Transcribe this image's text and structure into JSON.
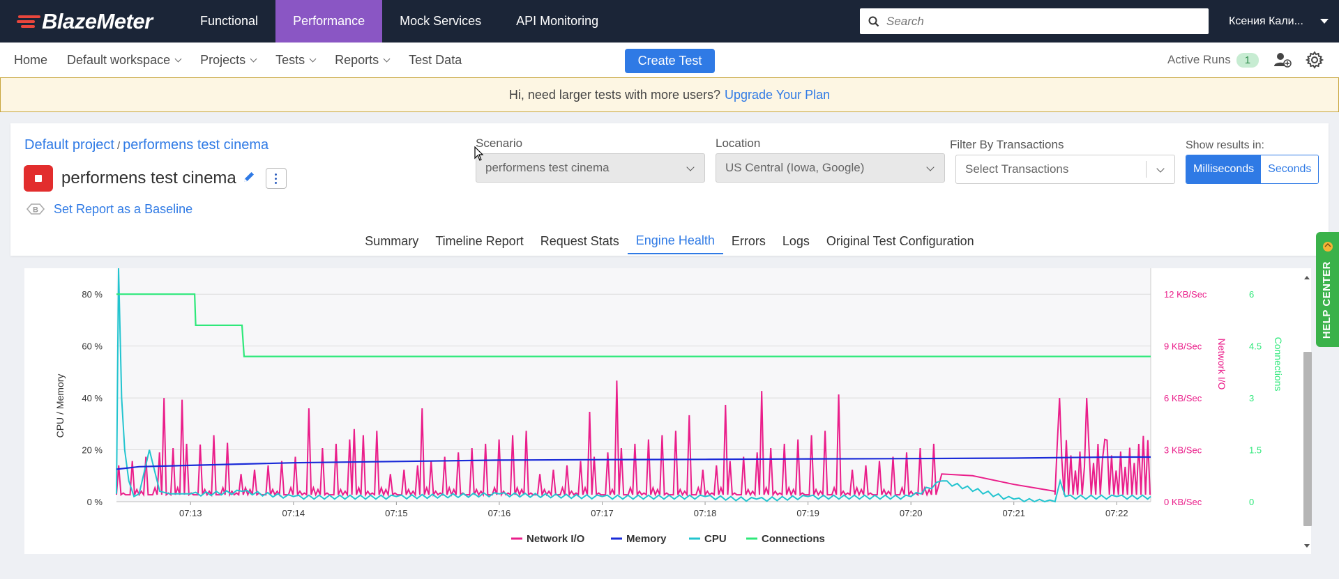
{
  "topnav": {
    "logo": "BlazeMeter",
    "items": [
      {
        "label": "Functional",
        "active": false
      },
      {
        "label": "Performance",
        "active": true
      },
      {
        "label": "Mock Services",
        "active": false
      },
      {
        "label": "API Monitoring",
        "active": false
      }
    ],
    "search_placeholder": "Search",
    "user_name": "Ксения Кали..."
  },
  "subnav": {
    "home": "Home",
    "workspace": "Default workspace",
    "projects": "Projects",
    "tests": "Tests",
    "reports": "Reports",
    "test_data": "Test Data",
    "create_test": "Create Test",
    "active_runs_label": "Active Runs",
    "active_runs_count": "1"
  },
  "banner": {
    "text": "Hi, need larger tests with more users?",
    "link": "Upgrade Your Plan"
  },
  "report": {
    "project": "Default project",
    "separator": "/",
    "test_link": "performens test cinema",
    "title": "performens test cinema",
    "baseline": "Set Report as a Baseline",
    "scenario_label": "Scenario",
    "scenario_value": "performens test cinema",
    "location_label": "Location",
    "location_value": "US Central (Iowa, Google)",
    "filter_label": "Filter By Transactions",
    "filter_placeholder": "Select Transactions",
    "show_results_label": "Show results in:",
    "unit_ms": "Milliseconds",
    "unit_s": "Seconds",
    "tabs": [
      "Summary",
      "Timeline Report",
      "Request Stats",
      "Engine Health",
      "Errors",
      "Logs",
      "Original Test Configuration"
    ],
    "active_tab": "Engine Health"
  },
  "help_center": "HELP CENTER",
  "colors": {
    "network": "#ea1e8a",
    "memory": "#1a2bd8",
    "cpu": "#22c4cf",
    "connections": "#2ee87a",
    "accent": "#2f7ae5"
  },
  "chart_data": {
    "type": "line",
    "ylabel_left": "CPU / Memory",
    "ylabel_right1": "Network I/O",
    "ylabel_right2": "Connections",
    "y_left_ticks": [
      "0 %",
      "20 %",
      "40 %",
      "60 %",
      "80 %"
    ],
    "y_left_range": [
      0,
      90
    ],
    "y_right1_ticks": [
      "0 KB/Sec",
      "3 KB/Sec",
      "6 KB/Sec",
      "9 KB/Sec",
      "12 KB/Sec"
    ],
    "y_right1_range": [
      0,
      13.5
    ],
    "y_right2_ticks": [
      "0",
      "1.5",
      "3",
      "4.5",
      "6"
    ],
    "y_right2_range": [
      0,
      6.75
    ],
    "x_ticks": [
      "07:13",
      "07:14",
      "07:15",
      "07:16",
      "07:17",
      "07:18",
      "07:19",
      "07:20",
      "07:21",
      "07:22"
    ],
    "x_range_minutes": [
      12.28,
      22.33
    ],
    "legend": [
      "Network I/O",
      "Memory",
      "CPU",
      "Connections"
    ],
    "series": [
      {
        "name": "Connections",
        "axis": "right2",
        "x": [
          12.28,
          12.3,
          13.04,
          13.05,
          13.5,
          13.52,
          22.33
        ],
        "y": [
          6,
          6,
          6,
          5.1,
          5.1,
          4.2,
          4.2
        ]
      },
      {
        "name": "Memory",
        "axis": "left",
        "x": [
          12.28,
          12.5,
          13.0,
          13.5,
          14.0,
          15.0,
          16.0,
          17.0,
          18.0,
          19.0,
          20.0,
          21.0,
          21.5,
          22.0,
          22.33
        ],
        "y": [
          12.5,
          13.5,
          14,
          14.5,
          15,
          15.5,
          16,
          16.2,
          16.3,
          16.5,
          16.6,
          16.8,
          17,
          17.2,
          17.2
        ]
      },
      {
        "name": "CPU",
        "axis": "left",
        "x": [
          12.28,
          12.3,
          12.33,
          12.36,
          12.4,
          12.45,
          12.5,
          12.6,
          12.7,
          12.8,
          13.0,
          13.5,
          14.0,
          15.0,
          16.0,
          17.0,
          18.0,
          18.5,
          19.0,
          20.0,
          20.3,
          21.0,
          21.4,
          21.45,
          21.5,
          22.0,
          22.33
        ],
        "y": [
          3,
          90,
          40,
          20,
          8,
          2,
          3,
          20,
          4,
          3,
          3,
          4,
          2,
          2,
          3,
          2,
          2,
          1,
          2,
          2,
          8,
          1,
          0,
          8,
          2,
          2,
          2
        ]
      },
      {
        "name": "Network I/O",
        "axis": "right1",
        "spike_times": [
          12.55,
          12.75,
          12.85,
          12.92,
          13.1,
          13.35,
          13.6,
          14.15,
          14.6,
          15.05,
          15.25,
          15.5,
          15.85,
          16.25,
          16.55,
          16.88,
          17.15,
          17.35,
          17.6,
          17.85,
          18.2,
          18.55,
          18.8,
          19.1,
          19.3,
          19.55,
          19.8,
          20.15,
          21.45,
          21.7,
          21.88,
          22.25
        ],
        "spike_heights": [
          6,
          6,
          6,
          5.9,
          3.3,
          3.4,
          4.2,
          5.4,
          4.2,
          5.4,
          5.4,
          3.6,
          3.8,
          6.4,
          5.6,
          5.2,
          7,
          6.2,
          5.2,
          5,
          5.6,
          6.4,
          3.6,
          3.8,
          6.2,
          5.2,
          4.8,
          4.4,
          6,
          6,
          3.6,
          3.8
        ],
        "base": 0.4,
        "tail_x": [
          20.3,
          20.6,
          21.0,
          21.4
        ],
        "tail_y": [
          1.6,
          1.5,
          1.0,
          0.6
        ]
      }
    ]
  }
}
